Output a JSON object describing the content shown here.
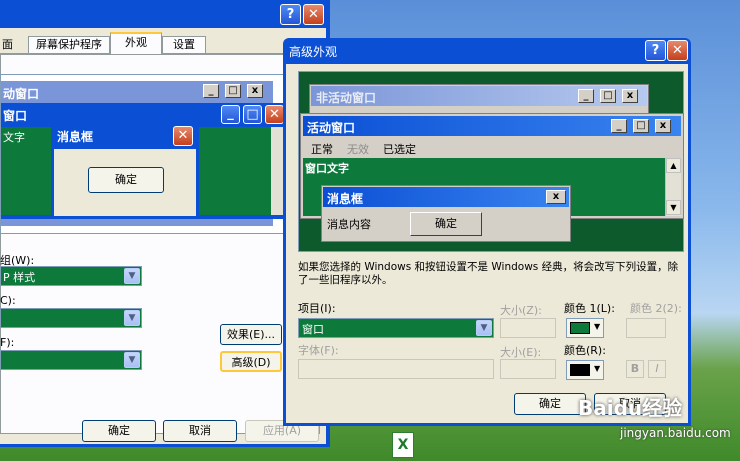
{
  "bg_window": {
    "tabs": [
      "面",
      "屏幕保护程序",
      "外观",
      "设置"
    ],
    "labels": [
      "组(W):",
      "C):",
      "F):"
    ],
    "combo1": "P 样式",
    "effects_btn": "效果(E)...",
    "advanced_btn": "高级(D)",
    "ok": "确定",
    "cancel": "取消",
    "apply": "应用(A)"
  },
  "preview_left": {
    "inactive_title": "动窗口",
    "active_title": "窗口",
    "body_text": "文字",
    "msgbox_title": "消息框",
    "msgbox_ok": "确定"
  },
  "dialog": {
    "title": "高级外观",
    "help": "?",
    "close": "X",
    "preview": {
      "inactive_title": "非活动窗口",
      "active_title": "活动窗口",
      "menu": {
        "normal": "正常",
        "disabled": "无效",
        "selected": "已选定"
      },
      "window_text": "窗口文字",
      "msgbox_title": "消息框",
      "msgbox_text": "消息内容",
      "msgbox_ok": "确定"
    },
    "info": "如果您选择的 Windows 和按钮设置不是 Windows 经典，将会改写下列设置，除了一些旧程序以外。",
    "item_label": "项目(I):",
    "item_value": "窗口",
    "size_label": "大小(Z):",
    "color1_label": "颜色 1(L):",
    "color2_label": "颜色 2(2):",
    "font_label": "字体(F):",
    "size2_label": "大小(E):",
    "color_label": "颜色(R):",
    "bold": "B",
    "italic": "I",
    "ok": "确定",
    "cancel": "取消"
  },
  "watermark": {
    "brand": "Baidu经验",
    "url": "jingyan.baidu.com"
  },
  "colors": {
    "xp_blue": "#0a5ce0",
    "green": "#0d7a3c",
    "face": "#ece9d8"
  }
}
